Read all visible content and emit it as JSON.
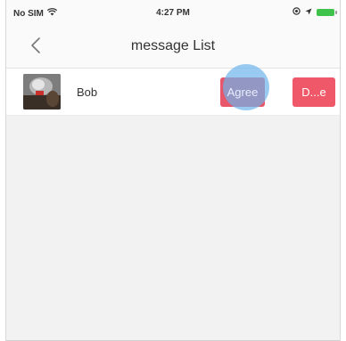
{
  "status_bar": {
    "carrier": "No SIM",
    "time": "4:27 PM",
    "battery_color": "#3ec24c"
  },
  "nav": {
    "title": "message List",
    "back_icon": "chevron-left-icon"
  },
  "messages": [
    {
      "name": "Bob",
      "agree_label": "Agree",
      "delete_label": "D...e"
    }
  ],
  "colors": {
    "button_red": "#ef5868",
    "touch_blue": "#6eb4eb"
  }
}
